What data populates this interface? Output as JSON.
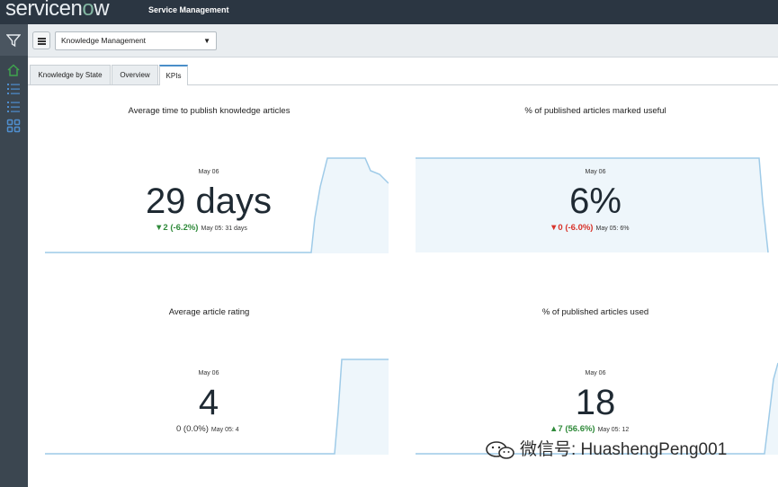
{
  "header": {
    "logo_text": "servicenow",
    "app_title": "Service Management"
  },
  "sidebar": {
    "icons": [
      "filter-icon",
      "home-icon",
      "list-icon",
      "list-icon",
      "grid-icon"
    ]
  },
  "toolbar": {
    "dashboard_select": "Knowledge Management"
  },
  "tabs": [
    {
      "label": "Knowledge by State",
      "active": false
    },
    {
      "label": "Overview",
      "active": false
    },
    {
      "label": "KPIs",
      "active": true
    }
  ],
  "kpis": [
    {
      "title": "Average time to publish knowledge articles",
      "date": "May 06",
      "value": "29 days",
      "delta": "▼2 (-6.2%)",
      "prev": "May 05: 31 days",
      "trend": "down-good"
    },
    {
      "title": "% of published articles marked useful",
      "date": "May 06",
      "value": "6%",
      "delta": "▼0 (-6.0%)",
      "prev": "May 05: 6%",
      "trend": "down-bad"
    },
    {
      "title": "Average article rating",
      "date": "May 06",
      "value": "4",
      "delta": "0 (0.0%)",
      "prev": "May 05: 4",
      "trend": "flat"
    },
    {
      "title": "% of published articles used",
      "date": "May 06",
      "value": "18",
      "delta": "▲7 (56.6%)",
      "prev": "May 05: 12",
      "trend": "up-good"
    }
  ],
  "colors": {
    "accent": "#4a8ec9",
    "good": "#2f8a3a",
    "bad": "#d8332a",
    "spark_fill": "#eef6fb",
    "spark_line": "#9fcbe8"
  },
  "watermark": {
    "text": "微信号: HuashengPeng001"
  }
}
